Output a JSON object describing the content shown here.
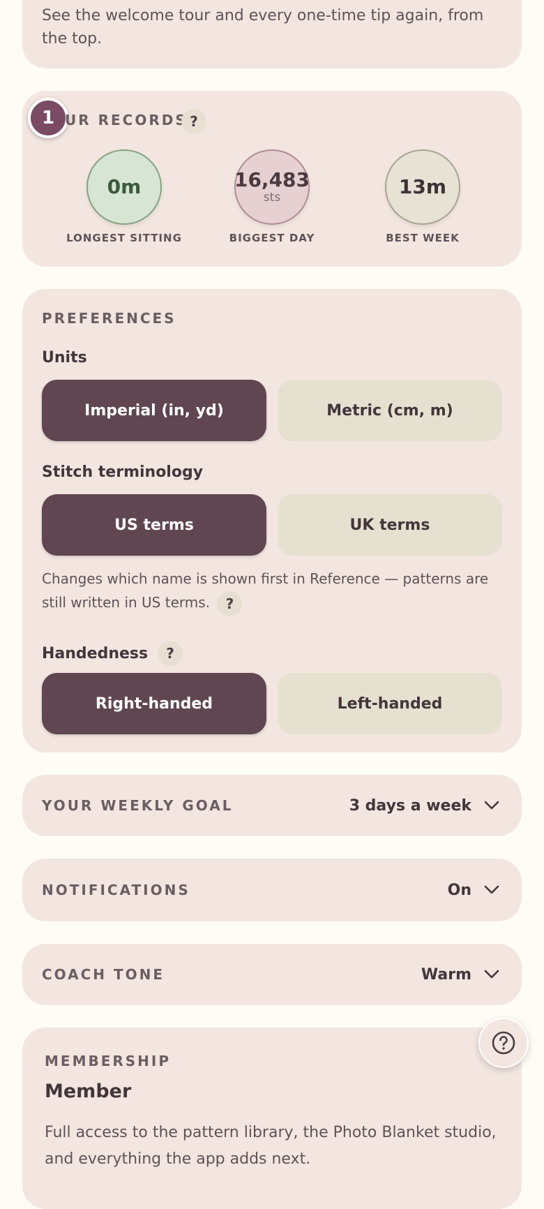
{
  "replay_tips": {
    "description": "See the welcome tour and every one-time tip again, from the top."
  },
  "records": {
    "step_badge": "1",
    "title": "UR RECORDS",
    "help": "?",
    "items": [
      {
        "value": "0m",
        "unit": "",
        "caption": "LONGEST SITTING"
      },
      {
        "value": "16,483",
        "unit": "sts",
        "caption": "BIGGEST DAY"
      },
      {
        "value": "13m",
        "unit": "",
        "caption": "BEST WEEK"
      }
    ]
  },
  "preferences": {
    "title": "PREFERENCES",
    "units": {
      "label": "Units",
      "options": [
        "Imperial (in, yd)",
        "Metric (cm, m)"
      ],
      "selected": "Imperial (in, yd)"
    },
    "terminology": {
      "label": "Stitch terminology",
      "options": [
        "US terms",
        "UK terms"
      ],
      "selected": "US terms",
      "hint": "Changes which name is shown first in Reference — patterns are still written in US terms.",
      "help": "?"
    },
    "handedness": {
      "label": "Handedness",
      "help": "?",
      "options": [
        "Right-handed",
        "Left-handed"
      ],
      "selected": "Right-handed"
    }
  },
  "weekly_goal": {
    "label": "YOUR WEEKLY GOAL",
    "value": "3 days a week"
  },
  "notifications": {
    "label": "NOTIFICATIONS",
    "value": "On"
  },
  "coach_tone": {
    "label": "COACH TONE",
    "value": "Warm"
  },
  "membership": {
    "title": "MEMBERSHIP",
    "tier": "Member",
    "description": "Full access to the pattern library, the Photo Blanket studio, and everything the app adds next."
  },
  "colors": {
    "accent": "#5f4650",
    "badge": "#7a4b62",
    "card": "#f3e6e0",
    "background": "#fffcf6"
  },
  "icons": {
    "chevron": "chevron-down-icon",
    "help_fab": "question-circle-icon"
  }
}
